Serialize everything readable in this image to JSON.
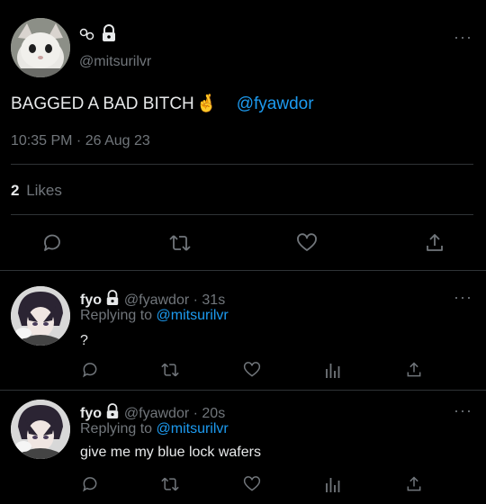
{
  "main_tweet": {
    "name_icons": [
      "link-icon",
      "lock-icon"
    ],
    "handle": "@mitsurilvr",
    "text": "BAGGED A BAD BITCH",
    "emoji": "🤞",
    "mention": "@fyawdor",
    "timestamp": "10:35 PM · 26 Aug 23",
    "likes_count": "2",
    "likes_label": "Likes",
    "more": "···"
  },
  "actions": [
    "reply-icon",
    "retweet-icon",
    "like-icon",
    "share-icon"
  ],
  "replies": [
    {
      "name": "fyo",
      "handle_time": "@fyawdor · 31s",
      "replying_prefix": "Replying to",
      "replying_to": "@mitsurilvr",
      "text": "?",
      "more": "···"
    },
    {
      "name": "fyo",
      "handle_time": "@fyawdor · 20s",
      "replying_prefix": "Replying to",
      "replying_to": "@mitsurilvr",
      "text": "give me my blue lock wafers",
      "more": "···"
    }
  ],
  "colors": {
    "accent": "#1d9bf0",
    "muted": "#71767b",
    "divider": "#2f3336",
    "background": "#000000"
  }
}
